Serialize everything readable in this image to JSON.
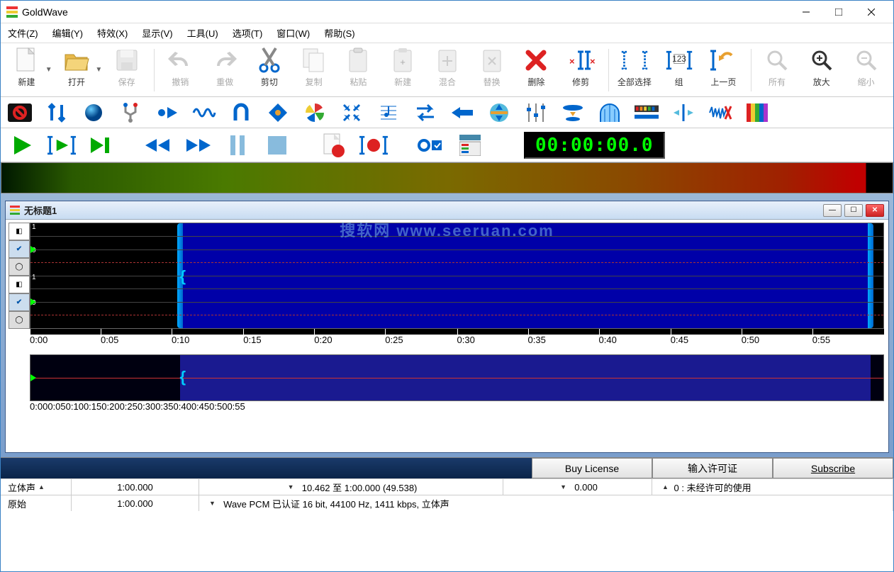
{
  "app": {
    "title": "GoldWave"
  },
  "menu": [
    "文件(Z)",
    "编辑(Y)",
    "特效(X)",
    "显示(V)",
    "工具(U)",
    "选项(T)",
    "窗口(W)",
    "帮助(S)"
  ],
  "toolbar_main": {
    "new": "新建",
    "open": "打开",
    "save": "保存",
    "undo": "撤销",
    "redo": "重做",
    "cut": "剪切",
    "copy": "复制",
    "paste": "粘贴",
    "pnew": "新建",
    "mix": "混合",
    "replace": "替换",
    "delete": "删除",
    "trim": "修剪",
    "selall": "全部选择",
    "group": "组",
    "prev": "上一页",
    "all": "所有",
    "zoomin": "放大",
    "zoomout": "缩小"
  },
  "transport": {
    "timecode": "00:00:00.0"
  },
  "document": {
    "title": "无标题1",
    "watermark": "搜软网 www.seeruan.com",
    "ruler": [
      "0:00",
      "0:05",
      "0:10",
      "0:15",
      "0:20",
      "0:25",
      "0:30",
      "0:35",
      "0:40",
      "0:45",
      "0:50",
      "0:55"
    ],
    "scale": [
      "1",
      "0",
      "1",
      "0"
    ]
  },
  "license": {
    "buy": "Buy License",
    "input": "输入许可证",
    "sub": "Subscribe"
  },
  "status": {
    "channels": "立体声",
    "dur": "1:00.000",
    "sel": "10.462 至 1:00.000 (49.538)",
    "pos": "0.000",
    "lic": "0 : 未经许可的使用",
    "mode": "原始",
    "dur2": "1:00.000",
    "fmt": "Wave PCM 已认证 16 bit, 44100 Hz, 1411 kbps, 立体声"
  }
}
